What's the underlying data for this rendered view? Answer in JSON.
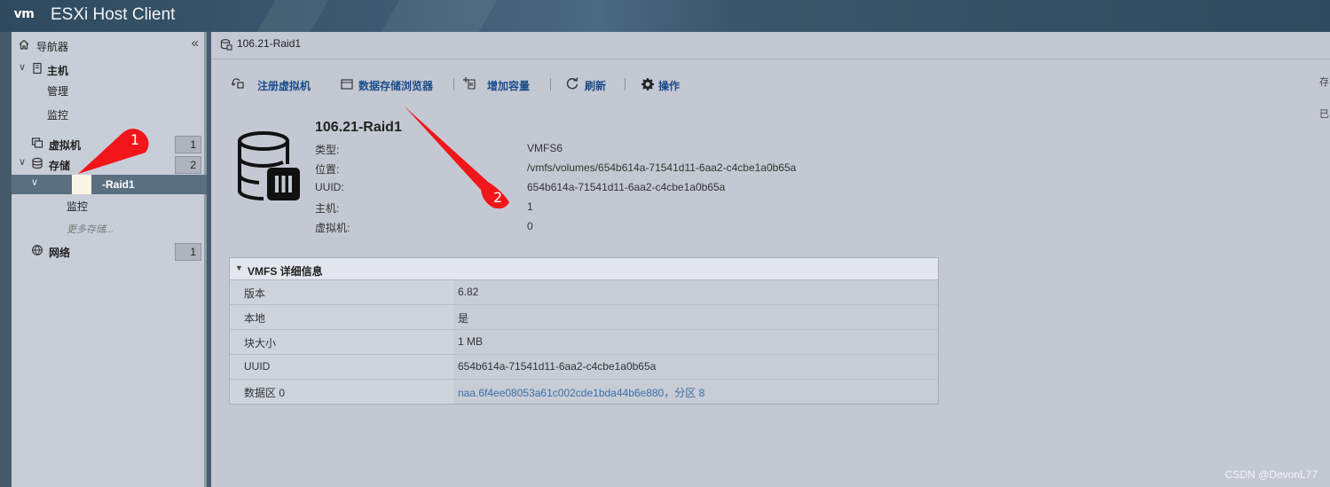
{
  "app": {
    "logo": "vm",
    "title": "ESXi Host Client"
  },
  "navigator": {
    "title": "导航器",
    "collapse_icon": "«",
    "items": [
      {
        "label": "主机",
        "caret": "∨",
        "icon": "host-icon"
      },
      {
        "label": "管理"
      },
      {
        "label": "监控"
      },
      {
        "label": "虚拟机",
        "icon": "vm-icon",
        "badge": "1"
      },
      {
        "label": "存储",
        "caret": "∨",
        "icon": "storage-icon",
        "badge": "2"
      },
      {
        "label": "-Raid1",
        "caret": "∨"
      },
      {
        "label": "监控"
      },
      {
        "label": "更多存储..."
      },
      {
        "label": "网络",
        "icon": "network-icon",
        "badge": "1"
      }
    ]
  },
  "breadcrumb": {
    "label": "106.21-Raid1"
  },
  "toolbar": {
    "register_vm": "注册虚拟机",
    "datastore_browser": "数据存储浏览器",
    "increase_capacity": "增加容量",
    "refresh": "刷新",
    "actions": "操作"
  },
  "datastore": {
    "name": "106.21-Raid1",
    "properties": [
      {
        "key": "类型:",
        "value": "VMFS6"
      },
      {
        "key": "位置:",
        "value": "/vmfs/volumes/654b614a-71541d11-6aa2-c4cbe1a0b65a"
      },
      {
        "key": "UUID:",
        "value": "654b614a-71541d11-6aa2-c4cbe1a0b65a"
      },
      {
        "key": "主机:",
        "value": "1"
      },
      {
        "key": "虚拟机:",
        "value": "0"
      }
    ]
  },
  "vmfs_panel": {
    "title": "VMFS 详细信息",
    "rows": [
      {
        "key": "版本",
        "value": "6.82"
      },
      {
        "key": "本地",
        "value": "是"
      },
      {
        "key": "块大小",
        "value": "1 MB"
      },
      {
        "key": "UUID",
        "value": "654b614a-71541d11-6aa2-c4cbe1a0b65a"
      },
      {
        "key": "数据区 0",
        "value": "naa.6f4ee08053a61c002cde1bda44b6e880，分区 8"
      }
    ]
  },
  "edge_labels": [
    "存",
    "已"
  ],
  "annotations": {
    "marker1": "1",
    "marker2": "2",
    "color": "#f2161b"
  },
  "watermark": "CSDN @DevonL77"
}
